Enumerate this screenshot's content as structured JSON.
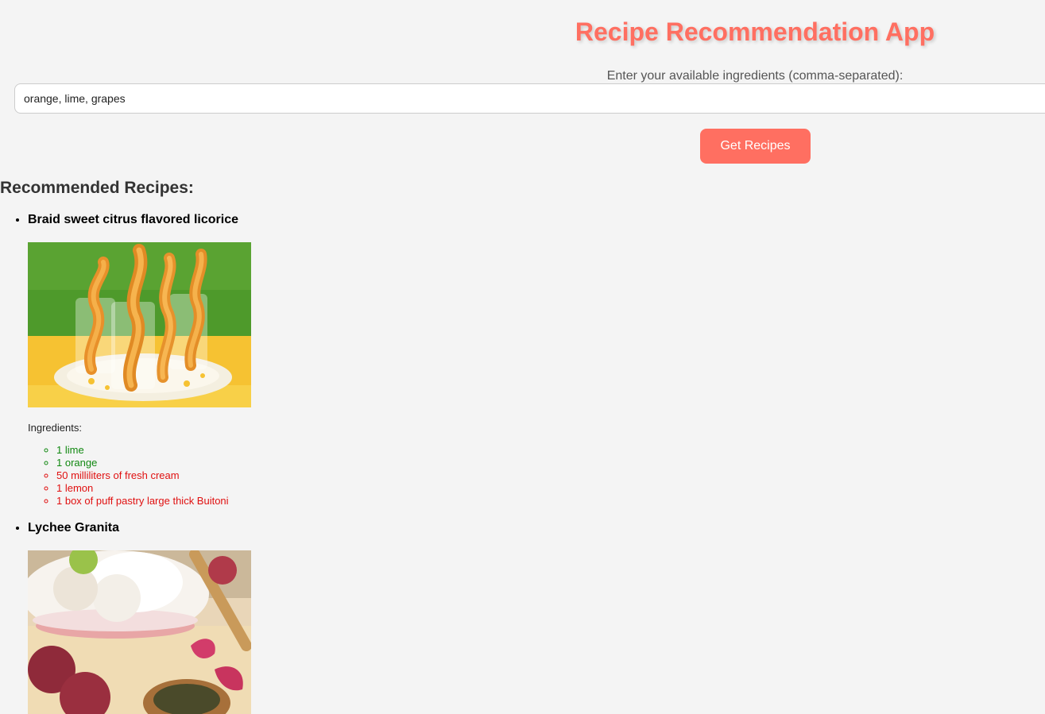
{
  "header": {
    "title": "Recipe Recommendation App"
  },
  "form": {
    "label": "Enter your available ingredients (comma-separated):",
    "input_value": "orange, lime, grapes",
    "submit_label": "Get Recipes"
  },
  "results": {
    "heading": "Recommended Recipes:",
    "recipes": [
      {
        "title": "Braid sweet citrus flavored licorice",
        "image": "photo-of-puff-pastry-twists-in-glasses",
        "ingredients_label": "Ingredients:",
        "ingredients": [
          {
            "text": "1 lime",
            "available": true
          },
          {
            "text": "1 orange",
            "available": true
          },
          {
            "text": "50 milliliters of fresh cream",
            "available": false
          },
          {
            "text": "1 lemon",
            "available": false
          },
          {
            "text": "1 box of puff pastry large thick Buitoni",
            "available": false
          }
        ]
      },
      {
        "title": "Lychee Granita",
        "image": "photo-of-lychee-granita-bowl"
      }
    ]
  },
  "colors": {
    "accent": "#ff6f61",
    "available_ingredient": "#118811",
    "missing_ingredient": "#e01010",
    "background": "#f4f4f4"
  }
}
